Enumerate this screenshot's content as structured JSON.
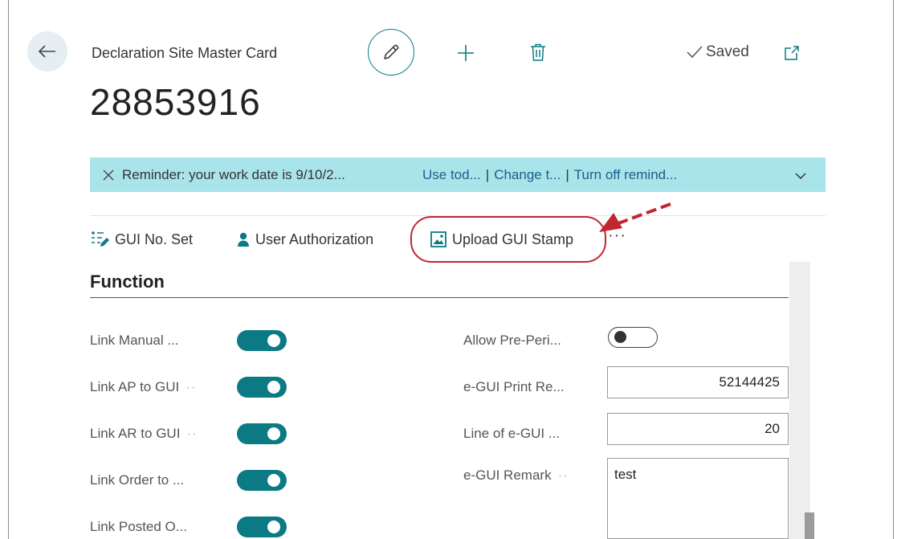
{
  "header": {
    "caption": "Declaration Site Master Card",
    "record_no": "28853916",
    "saved_label": "Saved"
  },
  "banner": {
    "message": "Reminder: your work date is 9/10/2...",
    "link_use_today": "Use tod...",
    "link_change": "Change t...",
    "link_turn_off": "Turn off remind..."
  },
  "actions": {
    "gui_no_set": "GUI No. Set",
    "user_authorization": "User Authorization",
    "upload_gui_stamp": "Upload GUI Stamp",
    "more": "···"
  },
  "section": {
    "title": "Function"
  },
  "fields_left": [
    {
      "label": "Link Manual ...",
      "value": true
    },
    {
      "label": "Link AP to GUI",
      "value": true
    },
    {
      "label": "Link AR to GUI",
      "value": true
    },
    {
      "label": "Link Order to ...",
      "value": true
    },
    {
      "label": "Link Posted O...",
      "value": true
    }
  ],
  "fields_right": {
    "allow_pre_period": {
      "label": "Allow Pre-Peri...",
      "value": false
    },
    "egui_print_report": {
      "label": "e-GUI Print Re...",
      "value": "52144425"
    },
    "line_of_egui": {
      "label": "Line of e-GUI ...",
      "value": "20"
    },
    "egui_remark": {
      "label": "e-GUI Remark",
      "value": "test"
    }
  },
  "colors": {
    "accent": "#0b7a84",
    "banner_bg": "#a9e4ea",
    "annotation": "#c0282e"
  },
  "icons": [
    "back-arrow-icon",
    "pencil-icon",
    "plus-icon",
    "trash-icon",
    "checkmark-icon",
    "open-in-new-window-icon",
    "close-icon",
    "chevron-down-icon",
    "number-series-icon",
    "user-icon",
    "image-icon"
  ]
}
